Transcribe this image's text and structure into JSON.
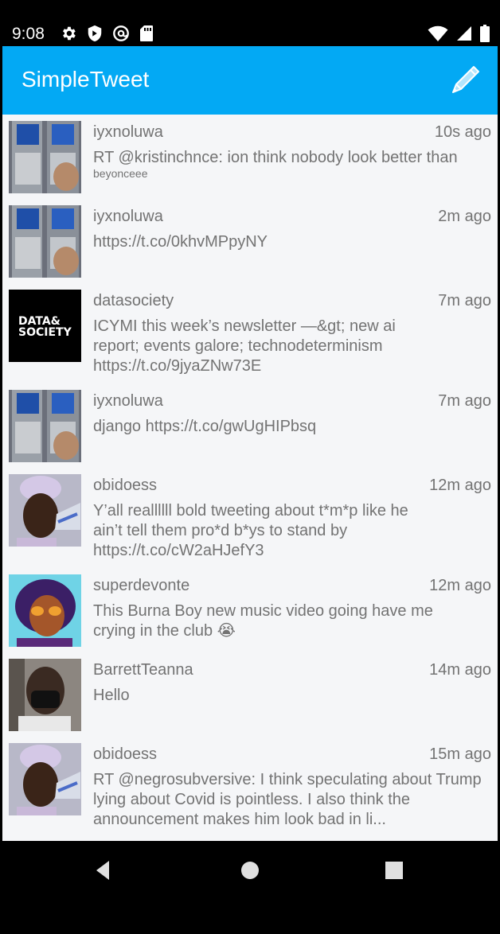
{
  "status_bar": {
    "time": "9:08",
    "left_icons": [
      "gear-icon",
      "shield-icon",
      "at-sign-icon",
      "sd-card-icon"
    ],
    "right_icons": [
      "wifi-icon",
      "signal-icon",
      "battery-icon"
    ]
  },
  "app_bar": {
    "title": "SimpleTweet",
    "compose_icon": "pencil-icon",
    "color": "#03A9F4"
  },
  "tweets": [
    {
      "user": "iyxnoluwa",
      "time": "10s ago",
      "text": "RT @kristinchnce: ion think nobody look better than",
      "subtext": "beyonceee",
      "avatar": "avatar-phone-photo"
    },
    {
      "user": "iyxnoluwa",
      "time": "2m ago",
      "text": "https://t.co/0khvMPpyNY",
      "avatar": "avatar-phone-photo"
    },
    {
      "user": "datasociety",
      "time": "7m ago",
      "text": "ICYMI this week’s newsletter —&gt; new ai report; events galore; technodeterminism https://t.co/9jyaZNw73E",
      "avatar": "avatar-data-society-logo",
      "logo_text_1": "DATA&",
      "logo_text_2": "SOCIETY"
    },
    {
      "user": "iyxnoluwa",
      "time": "7m ago",
      "text": "django https://t.co/gwUgHIPbsq",
      "avatar": "avatar-phone-photo"
    },
    {
      "user": "obidoess",
      "time": "12m ago",
      "text": "Y’all reallllll bold tweeting about t*m*p like he ain’t tell them pro*d b*ys to stand by https://t.co/cW2aHJefY3",
      "avatar": "avatar-person-durag"
    },
    {
      "user": "superdevonte",
      "time": "12m ago",
      "text": "This Burna Boy new music video going have me crying in the club 😭",
      "avatar": "avatar-cartoon-portrait"
    },
    {
      "user": "BarrettTeanna",
      "time": "14m ago",
      "text": "Hello",
      "avatar": "avatar-masked-person"
    },
    {
      "user": "obidoess",
      "time": "15m ago",
      "text": "RT @negrosubversive: I think speculating about Trump lying about Covid is pointless. I also think the announcement makes him look bad in li...",
      "avatar": "avatar-person-durag"
    }
  ],
  "nav_bar": {
    "buttons": [
      "back-icon",
      "home-icon",
      "recents-icon"
    ]
  }
}
